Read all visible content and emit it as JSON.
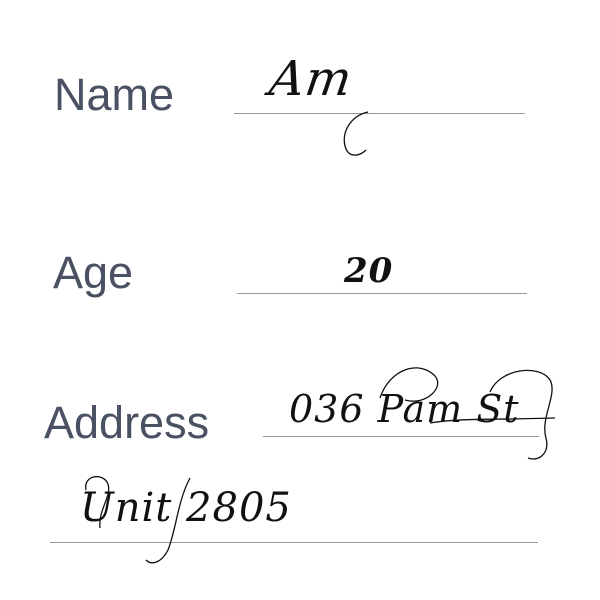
{
  "form": {
    "name": {
      "label": "Name",
      "value": "Am"
    },
    "age": {
      "label": "Age",
      "value": "20"
    },
    "address": {
      "label": "Address",
      "line1": "036 Pam St",
      "line2": "Unit 2805"
    }
  },
  "colors": {
    "label_text": "#4a5163",
    "handwriting": "#111111",
    "rule_line": "#9a9a9a",
    "background": "#ffffff"
  }
}
